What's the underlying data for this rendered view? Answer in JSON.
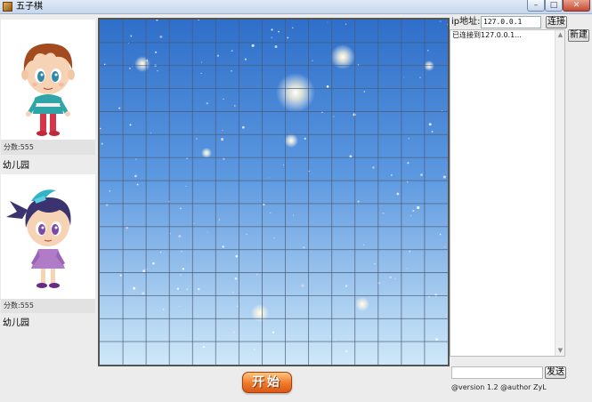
{
  "window": {
    "title": "五子棋",
    "minimize_glyph": "–",
    "maximize_glyph": "□",
    "close_glyph": "✕"
  },
  "icons": {
    "app": "gobang-app-icon",
    "player1": "boy-avatar",
    "player2": "girl-avatar"
  },
  "players": [
    {
      "score": "分数:555",
      "level": "幼儿园"
    },
    {
      "score": "分数:555",
      "level": "幼儿园"
    }
  ],
  "board": {
    "rows": 15,
    "cols": 15,
    "style": "starry-sky",
    "grid_color": "#4a5a74",
    "bg_top": "#2f6fc9",
    "bg_bottom": "#cfe8f8"
  },
  "start_button": {
    "label": "开始",
    "color": "#f07a2a"
  },
  "network": {
    "ip_label": "ip地址:",
    "ip_value": "127.0.0.1",
    "connect_label": "连接",
    "new_label": "新建",
    "log": [
      "已连接到127.0.0.1..."
    ],
    "send_label": "发送",
    "send_value": ""
  },
  "footer": {
    "version": "@version 1.2 @author ZyL"
  }
}
